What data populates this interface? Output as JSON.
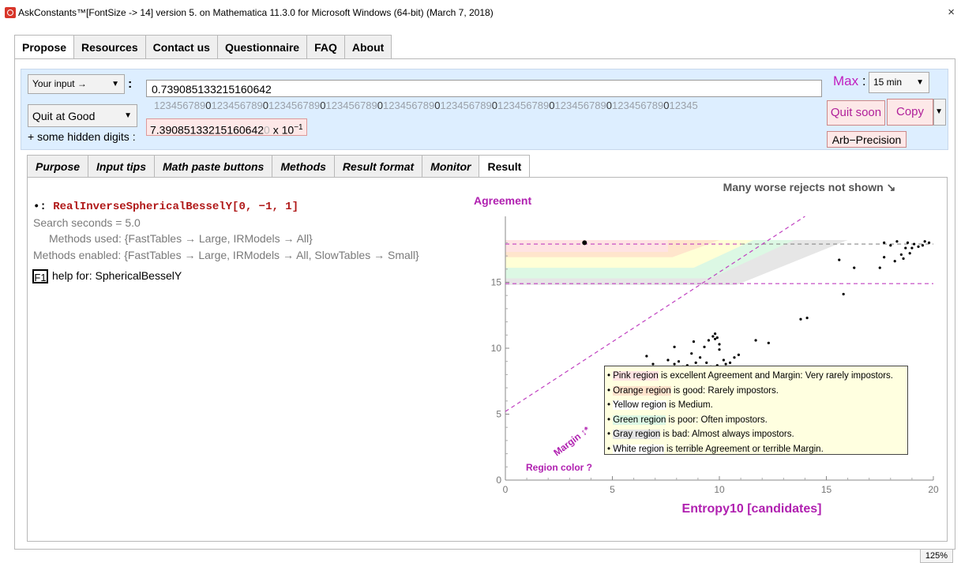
{
  "window": {
    "title": "AskConstants™[FontSize -> 14] version 5. on  Mathematica  11.3.0 for Microsoft Windows (64-bit) (March 7, 2018)",
    "close": "×"
  },
  "top_tabs": [
    "Propose",
    "Resources",
    "Contact us",
    "Questionnaire",
    "FAQ",
    "About"
  ],
  "input_panel": {
    "input_mode": "Your input →",
    "input_value": "0.739085133215160642",
    "quit_mode": "Quit at Good",
    "hidden_digits_label": "+ some hidden digits :",
    "digits_ruler": "12345678901234567890123456789012345678901234567890123456789012345678901234567890123456789012345",
    "result_mantissa": "7.39085133215160642",
    "result_trailing": "0",
    "result_exp_base": " x 10",
    "result_exp": "−1",
    "max_label": "Max",
    "max_value": "15 min",
    "quit_soon": "Quit soon",
    "copy": "Copy",
    "arb_precision": "Arb−Precision"
  },
  "sub_tabs": [
    "Purpose",
    "Input tips",
    "Math paste buttons",
    "Methods",
    "Result format",
    "Monitor",
    "Result"
  ],
  "result": {
    "bullet": "•: ",
    "function": "RealInverseSphericalBesselY[0, −1, 1]",
    "search_seconds": "Search seconds = 5.0",
    "methods_used": "Methods used: {FastTables → Large, IRModels → All}",
    "methods_enabled": "Methods enabled: {FastTables → Large, IRModels → All, SlowTables → Small}",
    "f1": "F1",
    "help": "help for:  SphericalBesselY"
  },
  "chart_data": {
    "type": "scatter",
    "title": "Many worse rejects not shown ↘",
    "xlabel": "Entropy10 [candidates]",
    "ylabel": "Agreement",
    "margin_label": "Margin ↕*",
    "region_label": "Region color ?",
    "xlim": [
      0,
      20
    ],
    "ylim": [
      0,
      20
    ],
    "xticks": [
      0,
      5,
      10,
      15,
      20
    ],
    "yticks": [
      0,
      5,
      10,
      15
    ],
    "hlines": [
      17.9,
      14.9
    ],
    "diagonal": {
      "from": [
        0,
        5.2
      ],
      "to": [
        14,
        20
      ]
    },
    "highlight_point": [
      3.7,
      18.0
    ],
    "points": [
      [
        6.6,
        9.4
      ],
      [
        6.9,
        8.8
      ],
      [
        7.1,
        8.4
      ],
      [
        7.3,
        8.1
      ],
      [
        7.5,
        8.5
      ],
      [
        7.6,
        9.1
      ],
      [
        7.9,
        8.8
      ],
      [
        7.9,
        10.1
      ],
      [
        8.1,
        9.0
      ],
      [
        8.3,
        8.6
      ],
      [
        8.5,
        8.7
      ],
      [
        8.6,
        8.4
      ],
      [
        8.7,
        9.6
      ],
      [
        8.8,
        10.5
      ],
      [
        8.9,
        8.9
      ],
      [
        9.0,
        8.6
      ],
      [
        9.1,
        9.3
      ],
      [
        9.2,
        8.5
      ],
      [
        9.3,
        10.1
      ],
      [
        9.4,
        8.9
      ],
      [
        9.5,
        10.6
      ],
      [
        9.6,
        8.6
      ],
      [
        9.7,
        8.4
      ],
      [
        9.7,
        10.9
      ],
      [
        9.8,
        11.1
      ],
      [
        9.8,
        10.7
      ],
      [
        9.9,
        10.8
      ],
      [
        9.9,
        8.7
      ],
      [
        10.0,
        10.3
      ],
      [
        10.0,
        9.9
      ],
      [
        10.2,
        9.1
      ],
      [
        10.3,
        8.8
      ],
      [
        10.5,
        8.9
      ],
      [
        10.7,
        9.3
      ],
      [
        10.9,
        9.5
      ],
      [
        11.7,
        10.6
      ],
      [
        12.3,
        10.4
      ],
      [
        13.8,
        12.2
      ],
      [
        14.1,
        12.3
      ],
      [
        15.6,
        16.7
      ],
      [
        15.8,
        14.1
      ],
      [
        16.3,
        16.1
      ],
      [
        17.5,
        16.1
      ],
      [
        17.7,
        16.9
      ],
      [
        17.7,
        18.0
      ],
      [
        18.0,
        17.8
      ],
      [
        18.2,
        16.6
      ],
      [
        18.3,
        18.1
      ],
      [
        18.5,
        17.1
      ],
      [
        18.6,
        16.8
      ],
      [
        18.7,
        17.6
      ],
      [
        18.8,
        18.0
      ],
      [
        18.9,
        17.2
      ],
      [
        19.0,
        17.6
      ],
      [
        19.1,
        17.9
      ],
      [
        19.3,
        17.7
      ],
      [
        19.5,
        17.8
      ],
      [
        19.6,
        18.1
      ],
      [
        19.8,
        18.0
      ]
    ]
  },
  "legend": {
    "items": [
      {
        "region": "Pink region",
        "text": " is excellent Agreement and Margin:  Very rarely impostors.",
        "color": "#ffe3e3"
      },
      {
        "region": "Orange region",
        "text": " is good:  Rarely impostors.",
        "color": "#ffe3cc"
      },
      {
        "region": "Yellow region",
        "text": " is Medium.",
        "color": "#ffffff"
      },
      {
        "region": "Green region",
        "text": " is poor:  Often impostors.",
        "color": "#dcf8e4"
      },
      {
        "region": "Gray region",
        "text": " is bad:  Almost always impostors.",
        "color": "#e4e4e4"
      },
      {
        "region": "White region",
        "text": " is terrible Agreement or terrible Margin.",
        "color": "#ffffff"
      }
    ]
  },
  "statusbar": {
    "zoom": "125%"
  }
}
